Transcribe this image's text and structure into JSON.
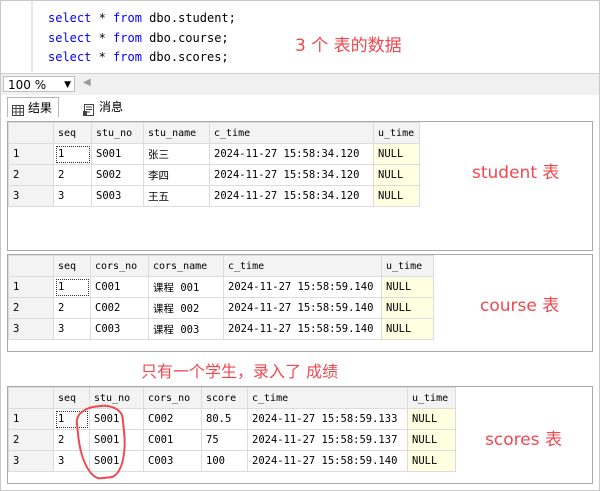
{
  "editor": {
    "lines": [
      {
        "kw1": "select",
        "mid": " * ",
        "kw2": "from",
        "rest": " dbo.student;"
      },
      {
        "kw1": "select",
        "mid": " * ",
        "kw2": "from",
        "rest": " dbo.course;"
      },
      {
        "kw1": "select",
        "mid": " * ",
        "kw2": "from",
        "rest": " dbo.scores;"
      }
    ],
    "note": "3 个 表的数据"
  },
  "zoom": {
    "value": "100 %"
  },
  "tabs": {
    "results": "结果",
    "messages": "消息"
  },
  "student": {
    "headers": [
      "",
      "seq",
      "stu_no",
      "stu_name",
      "c_time",
      "u_time"
    ],
    "rows": [
      [
        "1",
        "1",
        "S001",
        "张三",
        "2024-11-27 15:58:34.120",
        "NULL"
      ],
      [
        "2",
        "2",
        "S002",
        "李四",
        "2024-11-27 15:58:34.120",
        "NULL"
      ],
      [
        "3",
        "3",
        "S003",
        "王五",
        "2024-11-27 15:58:34.120",
        "NULL"
      ]
    ],
    "label": "student 表"
  },
  "course": {
    "headers": [
      "",
      "seq",
      "cors_no",
      "cors_name",
      "c_time",
      "u_time"
    ],
    "rows": [
      [
        "1",
        "1",
        "C001",
        "课程 001",
        "2024-11-27 15:58:59.140",
        "NULL"
      ],
      [
        "2",
        "2",
        "C002",
        "课程 002",
        "2024-11-27 15:58:59.140",
        "NULL"
      ],
      [
        "3",
        "3",
        "C003",
        "课程 003",
        "2024-11-27 15:58:59.140",
        "NULL"
      ]
    ],
    "label": "course 表"
  },
  "middle_note": "只有一个学生，录入了 成绩",
  "scores": {
    "headers": [
      "",
      "seq",
      "stu_no",
      "cors_no",
      "score",
      "c_time",
      "u_time"
    ],
    "rows": [
      [
        "1",
        "1",
        "S001",
        "C002",
        "80.5",
        "2024-11-27 15:58:59.133",
        "NULL"
      ],
      [
        "2",
        "2",
        "S001",
        "C001",
        "75",
        "2024-11-27 15:58:59.137",
        "NULL"
      ],
      [
        "3",
        "3",
        "S001",
        "C003",
        "100",
        "2024-11-27 15:58:59.140",
        "NULL"
      ]
    ],
    "label": "scores 表"
  },
  "colors": {
    "annotation": "#f0484f",
    "keyword": "#0000ff",
    "null_bg": "#ffffe1"
  }
}
